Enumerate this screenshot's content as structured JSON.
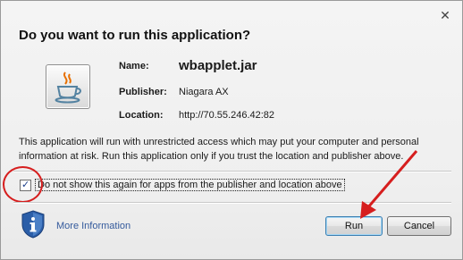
{
  "dialog": {
    "close_symbol": "✕",
    "title": "Do you want to run this application?"
  },
  "details": {
    "name_label": "Name:",
    "name_value": "wbapplet.jar",
    "publisher_label": "Publisher:",
    "publisher_value": "Niagara AX",
    "location_label": "Location:",
    "location_value": "http://70.55.246.42:82"
  },
  "warning_text": "This application will run with unrestricted access which may put your computer and personal information at risk. Run this application only if you trust the location and publisher above.",
  "checkbox": {
    "checked": true,
    "check_symbol": "✓",
    "label": "Do not show this again for apps from the publisher and location above"
  },
  "footer": {
    "more_info": "More Information",
    "run_label": "Run",
    "cancel_label": "Cancel"
  },
  "colors": {
    "annotation_red": "#d61e1e",
    "link_blue": "#345a9c",
    "shield_blue": "#2b5ea8"
  },
  "icons": [
    "java-cup-icon",
    "info-shield-icon",
    "close-icon"
  ]
}
